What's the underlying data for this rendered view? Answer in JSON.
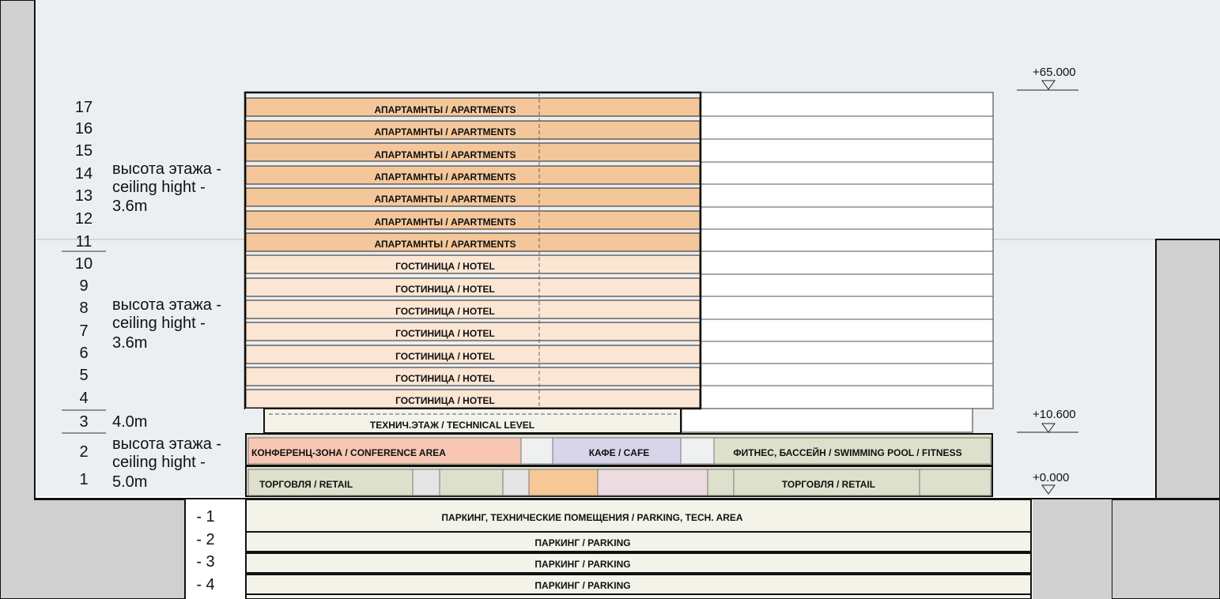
{
  "floor_numbers": [
    "17",
    "16",
    "15",
    "14",
    "13",
    "12",
    "11",
    "10",
    "9",
    "8",
    "7",
    "6",
    "5",
    "4",
    "3",
    "2",
    "1",
    "- 1",
    "- 2",
    "- 3",
    "- 4"
  ],
  "height_notes": {
    "upper": [
      "высота этажа -",
      "ceiling hight -",
      "3.6m"
    ],
    "middle": [
      "высота этажа -",
      "ceiling hight -",
      "3.6m"
    ],
    "technical": "4.0m",
    "lower": [
      "высота этажа -",
      "ceiling hight -",
      "5.0m"
    ]
  },
  "elevations": [
    "+65.000",
    "+10.600",
    "+0.000"
  ],
  "zones": {
    "apartments": "АПАРТАМНТЫ / APARTMENTS",
    "hotel": "ГОСТИНИЦА / HOTEL",
    "technical": "ТЕХНИЧ.ЭТАЖ / TECHNICAL LEVEL",
    "conference": "КОНФЕРЕНЦ-ЗОНА / CONFERENCE AREA",
    "cafe": "КАФЕ / CAFE",
    "fitness": "ФИТНЕС, БАССЕЙН / SWIMMING POOL / FITNESS",
    "retail_left": "ТОРГОВЛЯ / RETAIL",
    "retail_right": "ТОРГОВЛЯ / RETAIL",
    "parking_tech": "ПАРКИНГ, ТЕХНИЧЕСКИЕ ПОМЕЩЕНИЯ / PARKING, TECH. AREA",
    "parking": "ПАРКИНГ / PARKING"
  },
  "colors": {
    "sky": "#eceff2",
    "ground": "#d0d0d0",
    "apartments": "#f4c79a",
    "hotel": "#fbe6d3",
    "conference": "#f7c7b3",
    "cafe": "#d9d4ea",
    "retail": "#dfe0cc",
    "parking": "#f3f3ea",
    "retail_orange": "#f6c896",
    "retail_pink": "#eddcdf"
  }
}
